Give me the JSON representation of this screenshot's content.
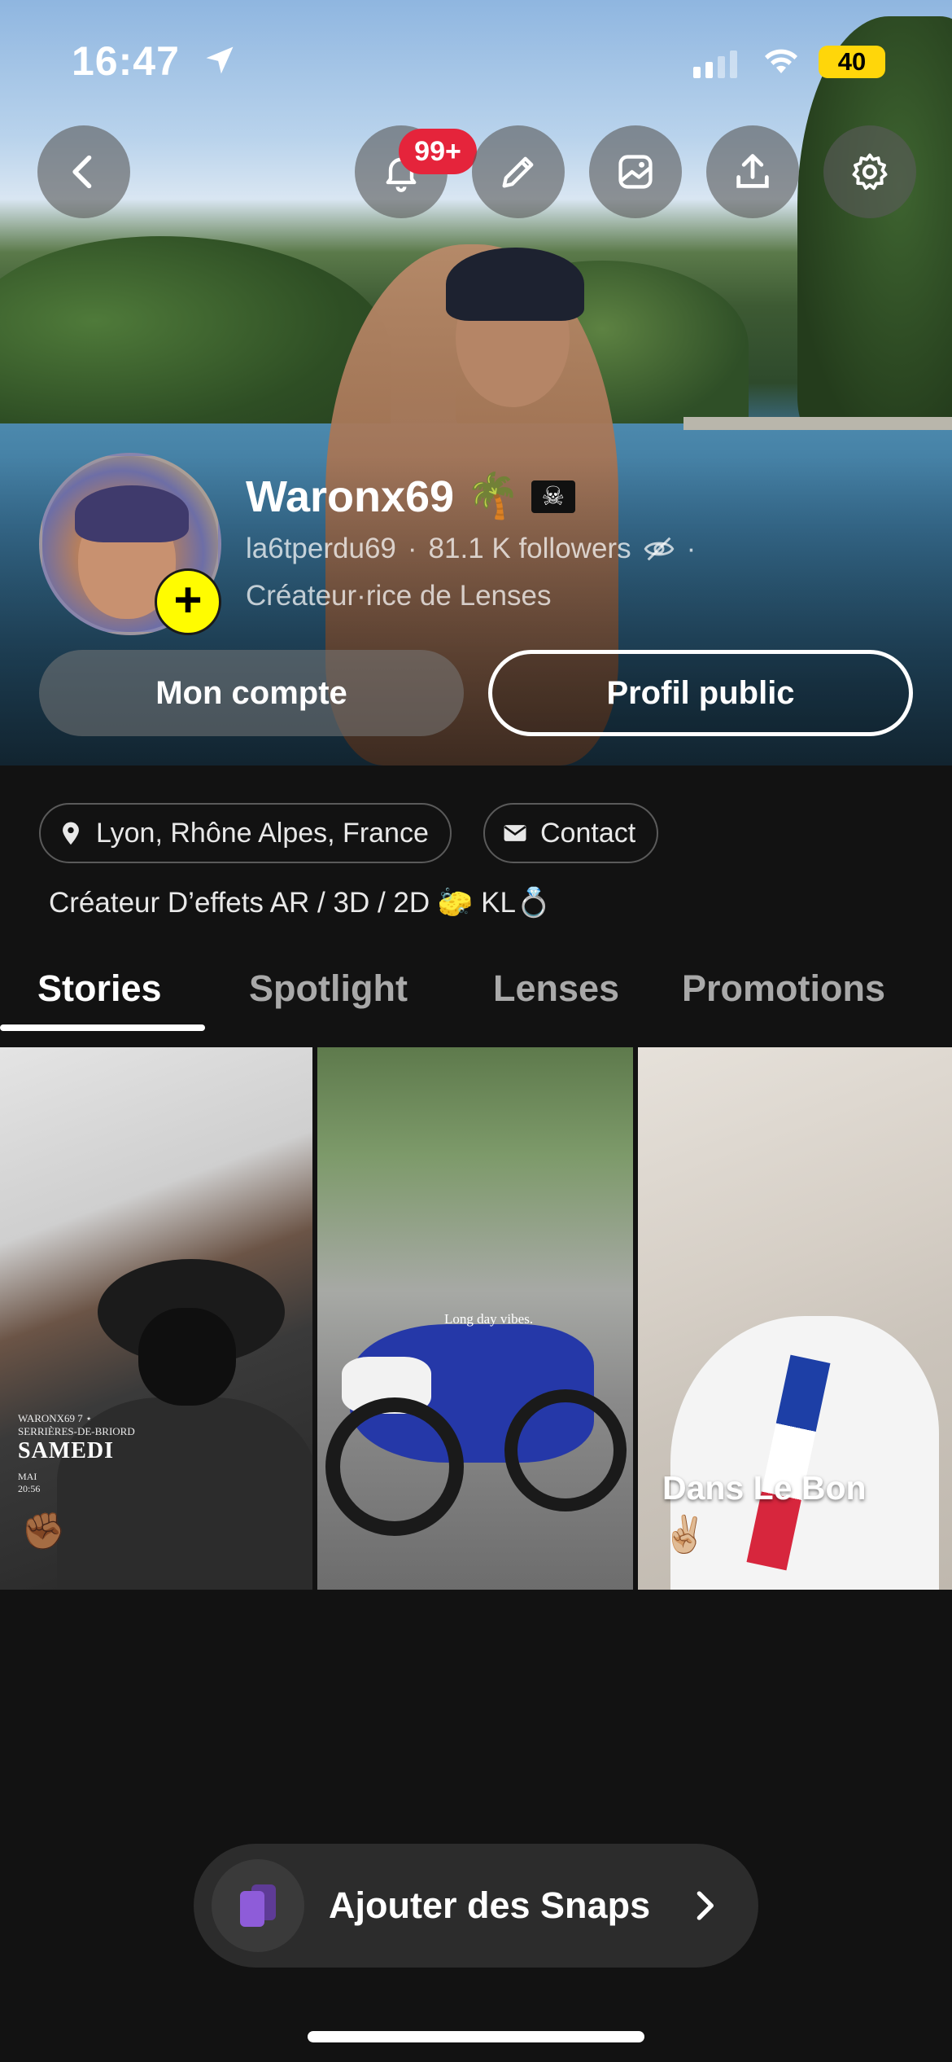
{
  "status": {
    "time": "16:47",
    "battery": "40",
    "signal_bars": 2,
    "icons": [
      "location-arrow-icon",
      "cellular-signal-icon",
      "wifi-icon",
      "battery-icon"
    ]
  },
  "topbar": {
    "icons": [
      "back-icon",
      "bell-icon",
      "pencil-icon",
      "gallery-icon",
      "share-icon",
      "gear-icon"
    ],
    "notifications_badge": "99+"
  },
  "profile": {
    "display_name": "Waronx69",
    "name_emojis": "🌴",
    "username": "la6tperdu69",
    "followers": "81.1 K followers",
    "separator": "·",
    "role": "Créateur·rice de Lenses",
    "add_button": "+"
  },
  "actions": {
    "my_account": "Mon compte",
    "public_profile": "Profil public"
  },
  "chips": {
    "location": "Lyon, Rhône Alpes, France",
    "contact": "Contact"
  },
  "bio": "Créateur D’effets AR / 3D / 2D 🧽 KL💍",
  "tabs": [
    "Stories",
    "Spotlight",
    "Lenses",
    "Promotions"
  ],
  "active_tab": "Stories",
  "stories": [
    {
      "caption_small": "WARONX69 7 ⋆\nSERRIÈRES-DE-BRIORD",
      "caption_day": "SAMEDI",
      "caption_date": "MAI\n20:56",
      "emoji": "✊🏾"
    },
    {
      "caption": "Long day vibes."
    },
    {
      "caption": "Dans Le Bon",
      "emoji": "✌🏼"
    }
  ],
  "add_snaps": {
    "label": "Ajouter des Snaps"
  },
  "colors": {
    "accent_yellow": "#FFFC00",
    "badge_red": "#E5243B",
    "background": "#121212",
    "snap_purple": "#8E5CD9"
  }
}
